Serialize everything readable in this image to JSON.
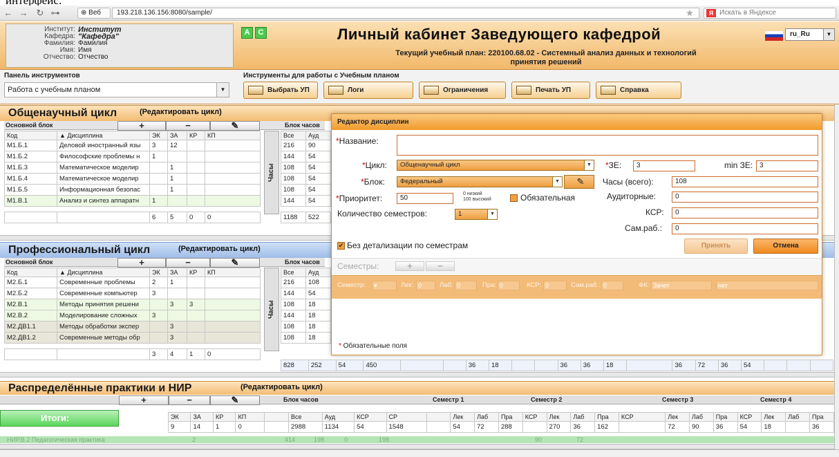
{
  "top_fragment": "интерфейс:",
  "browser": {
    "back": "←",
    "forward": "→",
    "reload": "↻",
    "key": "⊶",
    "tab": "Веб",
    "url": "193.218.136.156:8080/sample/",
    "star": "★",
    "search_placeholder": "Искать в Яндексе",
    "search_engine": "Я"
  },
  "header": {
    "user": {
      "institute_label": "Институт:",
      "institute_value": "Институт",
      "department_label": "Кафедра:",
      "department_value": "\"Кафедра\"",
      "surname_label": "Фамилия:",
      "surname_value": "Фамилия",
      "name_label": "Имя:",
      "name_value": "Имя",
      "patronymic_label": "Отчество:",
      "patronymic_value": "Отчество"
    },
    "mode_a": "A",
    "mode_c": "C",
    "title": "Личный кабинет Заведующего кафедрой",
    "lang": "ru_Ru",
    "plan_line1": "Текущий учебный план: 220100.68.02 - Системный анализ данных и технологий",
    "plan_line2": "принятия решений"
  },
  "toolbar": {
    "panel_title": "Панель инструментов",
    "panel_select": "Работа с учебным планом",
    "tools_title": "Инструменты для работы с Учебным планом",
    "buttons": [
      "Выбрать УП",
      "Логи",
      "Ограничения",
      "Печать УП",
      "Справка"
    ]
  },
  "cycles": [
    {
      "title": "Общенаучный цикл",
      "edit": "(Редактировать цикл)",
      "block": "Основной блок",
      "hours_block": "Блок часов",
      "vertical": "Часы",
      "headers": [
        "Код",
        "▲ Дисциплина",
        "ЭК",
        "ЗА",
        "КР",
        "КП"
      ],
      "hours_headers": [
        "Все",
        "Ауд"
      ],
      "rows": [
        [
          "М1.Б.1",
          "Деловой иностранный язы",
          "3",
          "12",
          "",
          "",
          "216",
          "90"
        ],
        [
          "М1.Б.2",
          "Философские проблемы н",
          "1",
          "",
          "",
          "",
          "144",
          "54"
        ],
        [
          "М1.Б.3",
          "Математическое моделир",
          "",
          "1",
          "",
          "",
          "108",
          "54"
        ],
        [
          "М1.Б.4",
          "Математическое моделир",
          "",
          "1",
          "",
          "",
          "108",
          "54"
        ],
        [
          "М1.Б.5",
          "Информационная безопас",
          "",
          "1",
          "",
          "",
          "108",
          "54"
        ],
        [
          "М1.В.1",
          "Анализ и синтез аппаратн",
          "1",
          "",
          "",
          "",
          "144",
          "54"
        ]
      ],
      "totals": [
        "6",
        "5",
        "0",
        "0",
        "1188",
        "522"
      ]
    },
    {
      "title": "Профессиональный цикл",
      "edit": "(Редактировать цикл)",
      "block": "Основной блок",
      "hours_block": "Блок часов",
      "vertical": "Часы",
      "headers": [
        "Код",
        "▲ Дисциплина",
        "ЭК",
        "ЗА",
        "КР",
        "КП"
      ],
      "hours_headers": [
        "Все",
        "Ауд"
      ],
      "rows": [
        [
          "М2.Б.1",
          "Современные проблемы",
          "2",
          "1",
          "",
          "",
          "216",
          "108"
        ],
        [
          "М2.Б.2",
          "Современные компьютер",
          "3",
          "",
          "",
          "",
          "144",
          "54"
        ],
        [
          "М2.В.1",
          "Методы принятия решени",
          "",
          "3",
          "3",
          "",
          "108",
          "18"
        ],
        [
          "М2.В.2",
          "Моделирование сложных",
          "3",
          "",
          "",
          "",
          "144",
          "18"
        ],
        [
          "М2.ДВ1.1",
          "Методы обработки экспер",
          "",
          "3",
          "",
          "",
          "108",
          "18"
        ],
        [
          "М2.ДВ1.2",
          "Современные методы обр",
          "",
          "3",
          "",
          "",
          "108",
          "18"
        ]
      ],
      "totals": [
        "3",
        "4",
        "1",
        "0",
        "828",
        "252",
        "54",
        "450",
        "36",
        "18",
        "36",
        "36",
        "18",
        "36",
        "72",
        "36",
        "54"
      ]
    }
  ],
  "practice": {
    "title": "Распределённые практики и НИР",
    "edit": "(Редактировать цикл)",
    "hours_block": "Блок часов",
    "sem1": "Семестр 1",
    "sem2": "Семестр 2",
    "sem3": "Семестр 3",
    "sem4": "Семестр 4",
    "headers": [
      "ЭК",
      "ЗА",
      "КР",
      "КП",
      "Все",
      "Ауд",
      "КСР",
      "СР",
      "Лек",
      "Лаб",
      "Пра",
      "КСР",
      "Лек",
      "Лаб",
      "Пра",
      "КСР",
      "Лек",
      "Лаб",
      "Пра",
      "КСР",
      "Лек",
      "Лаб",
      "Пра"
    ],
    "values": [
      "9",
      "14",
      "1",
      "0",
      "2988",
      "1134",
      "54",
      "1548",
      "54",
      "72",
      "288",
      "",
      "270",
      "36",
      "162",
      "",
      "72",
      "90",
      "36",
      "54",
      "18",
      "",
      "36"
    ],
    "hidden_row": "НИР.В.2   Педагогическая практика",
    "hidden_vals": [
      "2",
      "414",
      "198",
      "0",
      "198",
      "90",
      "72"
    ]
  },
  "itogi": "Итоги:",
  "modal": {
    "title": "Редактор дисциплин",
    "name_label": "Название:",
    "name_value": "",
    "cycle_label": "Цикл:",
    "cycle_value": "Общенаучный цикл",
    "block_label": "Блок:",
    "block_value": "Федеральный",
    "priority_label": "Приоритет:",
    "priority_value": "50",
    "priority_hint1": "0 низкий",
    "priority_hint2": "100 высокий",
    "mandatory_label": "Обязательная",
    "sem_count_label": "Количество семестров:",
    "sem_count_value": "1",
    "ze_label": "ЗЕ:",
    "ze_value": "3",
    "minze_label": "min ЗЕ:",
    "minze_value": "3",
    "hours_label": "Часы (всего):",
    "hours_value": "108",
    "aud_label": "Аудиторные:",
    "aud_value": "0",
    "ksr_label": "КСР:",
    "ksr_value": "0",
    "sam_label": "Сам.раб.:",
    "sam_value": "0",
    "nodetail_label": "Без детализации по семестрам",
    "accept": "Принять",
    "cancel": "Отмена",
    "semesters_label": "Семестры:",
    "sem_row": {
      "semestr": "Семестр:",
      "lek": "Лек:",
      "lek_v": "0",
      "lab": "Лаб:",
      "lab_v": "0",
      "pra": "Пра:",
      "pra_v": "0",
      "ksr": "КСР:",
      "ksr_v": "0",
      "sam": "Сам.раб.:",
      "sam_v": "0",
      "fk": "ФК:",
      "fk_v": "Зачет",
      "net": "нет"
    },
    "required_note": "Обязательные поля"
  }
}
